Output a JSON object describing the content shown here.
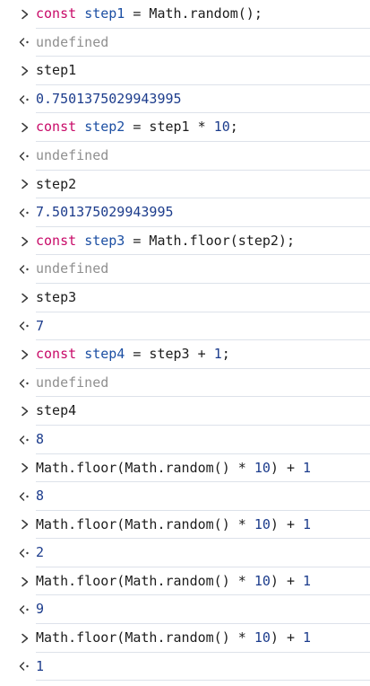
{
  "colors": {
    "keyword": "#c80a68",
    "definition": "#1c4fa3",
    "number": "#1c3c8c",
    "undefined": "#8f8f8f",
    "text": "#1c1c1c",
    "divider": "#dde2ea",
    "prompt_glyph": "#3a3a3a"
  },
  "icons": {
    "input": "chevron-right-icon",
    "output": "return-arrow-icon"
  },
  "entries": [
    {
      "type": "input",
      "tokens": [
        {
          "t": "const",
          "c": "keyword"
        },
        {
          "t": " ",
          "c": "plain"
        },
        {
          "t": "step1",
          "c": "def"
        },
        {
          "t": " = Math.random();",
          "c": "plain"
        }
      ]
    },
    {
      "type": "output",
      "tokens": [
        {
          "t": "undefined",
          "c": "undefined"
        }
      ]
    },
    {
      "type": "input",
      "tokens": [
        {
          "t": "step1",
          "c": "plain"
        }
      ]
    },
    {
      "type": "output",
      "tokens": [
        {
          "t": "0.7501375029943995",
          "c": "number"
        }
      ]
    },
    {
      "type": "input",
      "tokens": [
        {
          "t": "const",
          "c": "keyword"
        },
        {
          "t": " ",
          "c": "plain"
        },
        {
          "t": "step2",
          "c": "def"
        },
        {
          "t": " = step1 * ",
          "c": "plain"
        },
        {
          "t": "10",
          "c": "number"
        },
        {
          "t": ";",
          "c": "plain"
        }
      ]
    },
    {
      "type": "output",
      "tokens": [
        {
          "t": "undefined",
          "c": "undefined"
        }
      ]
    },
    {
      "type": "input",
      "tokens": [
        {
          "t": "step2",
          "c": "plain"
        }
      ]
    },
    {
      "type": "output",
      "tokens": [
        {
          "t": "7.501375029943995",
          "c": "number"
        }
      ]
    },
    {
      "type": "input",
      "tokens": [
        {
          "t": "const",
          "c": "keyword"
        },
        {
          "t": " ",
          "c": "plain"
        },
        {
          "t": "step3",
          "c": "def"
        },
        {
          "t": " = Math.floor(step2);",
          "c": "plain"
        }
      ]
    },
    {
      "type": "output",
      "tokens": [
        {
          "t": "undefined",
          "c": "undefined"
        }
      ]
    },
    {
      "type": "input",
      "tokens": [
        {
          "t": "step3",
          "c": "plain"
        }
      ]
    },
    {
      "type": "output",
      "tokens": [
        {
          "t": "7",
          "c": "number"
        }
      ]
    },
    {
      "type": "input",
      "tokens": [
        {
          "t": "const",
          "c": "keyword"
        },
        {
          "t": " ",
          "c": "plain"
        },
        {
          "t": "step4",
          "c": "def"
        },
        {
          "t": " = step3 + ",
          "c": "plain"
        },
        {
          "t": "1",
          "c": "number"
        },
        {
          "t": ";",
          "c": "plain"
        }
      ]
    },
    {
      "type": "output",
      "tokens": [
        {
          "t": "undefined",
          "c": "undefined"
        }
      ]
    },
    {
      "type": "input",
      "tokens": [
        {
          "t": "step4",
          "c": "plain"
        }
      ]
    },
    {
      "type": "output",
      "tokens": [
        {
          "t": "8",
          "c": "number"
        }
      ]
    },
    {
      "type": "input",
      "tokens": [
        {
          "t": "Math.floor(Math.random() * ",
          "c": "plain"
        },
        {
          "t": "10",
          "c": "number"
        },
        {
          "t": ") + ",
          "c": "plain"
        },
        {
          "t": "1",
          "c": "number"
        }
      ]
    },
    {
      "type": "output",
      "tokens": [
        {
          "t": "8",
          "c": "number"
        }
      ]
    },
    {
      "type": "input",
      "tokens": [
        {
          "t": "Math.floor(Math.random() * ",
          "c": "plain"
        },
        {
          "t": "10",
          "c": "number"
        },
        {
          "t": ") + ",
          "c": "plain"
        },
        {
          "t": "1",
          "c": "number"
        }
      ]
    },
    {
      "type": "output",
      "tokens": [
        {
          "t": "2",
          "c": "number"
        }
      ]
    },
    {
      "type": "input",
      "tokens": [
        {
          "t": "Math.floor(Math.random() * ",
          "c": "plain"
        },
        {
          "t": "10",
          "c": "number"
        },
        {
          "t": ") + ",
          "c": "plain"
        },
        {
          "t": "1",
          "c": "number"
        }
      ]
    },
    {
      "type": "output",
      "tokens": [
        {
          "t": "9",
          "c": "number"
        }
      ]
    },
    {
      "type": "input",
      "tokens": [
        {
          "t": "Math.floor(Math.random() * ",
          "c": "plain"
        },
        {
          "t": "10",
          "c": "number"
        },
        {
          "t": ") + ",
          "c": "plain"
        },
        {
          "t": "1",
          "c": "number"
        }
      ]
    },
    {
      "type": "output",
      "tokens": [
        {
          "t": "1",
          "c": "number"
        }
      ]
    }
  ]
}
